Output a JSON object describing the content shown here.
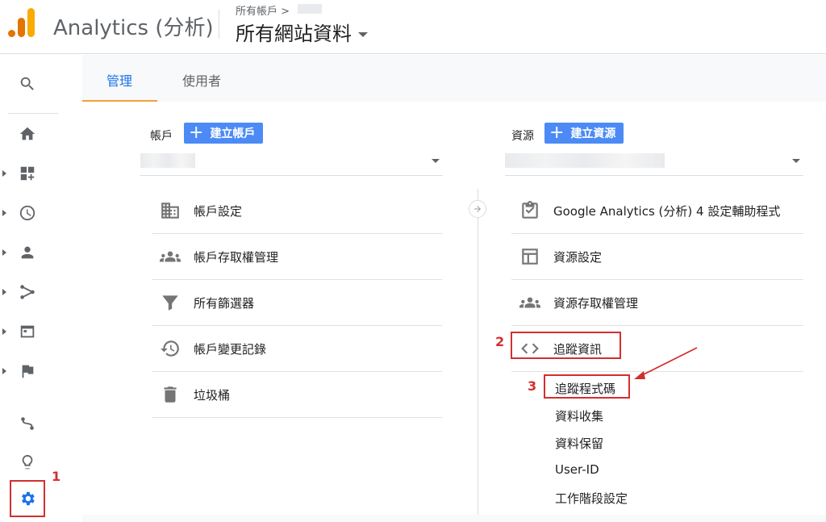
{
  "header": {
    "app_title": "Analytics (分析)",
    "breadcrumb": "所有帳戶 >",
    "property": "所有網站資料"
  },
  "tabs": [
    {
      "label": "管理"
    },
    {
      "label": "使用者"
    }
  ],
  "account_column": {
    "label": "帳戶",
    "create_button": "建立帳戶",
    "items": [
      {
        "label": "帳戶設定",
        "icon": "building-icon"
      },
      {
        "label": "帳戶存取權管理",
        "icon": "people-icon"
      },
      {
        "label": "所有篩選器",
        "icon": "filter-icon"
      },
      {
        "label": "帳戶變更記錄",
        "icon": "history-icon"
      },
      {
        "label": "垃圾桶",
        "icon": "trash-icon"
      }
    ]
  },
  "property_column": {
    "label": "資源",
    "create_button": "建立資源",
    "items": [
      {
        "label": "Google Analytics (分析) 4 設定輔助程式",
        "icon": "clipboard-check-icon"
      },
      {
        "label": "資源設定",
        "icon": "layout-icon"
      },
      {
        "label": "資源存取權管理",
        "icon": "people-icon"
      },
      {
        "label": "追蹤資訊",
        "icon": "code-icon"
      }
    ],
    "sub_items": [
      {
        "label": "追蹤程式碼"
      },
      {
        "label": "資料收集"
      },
      {
        "label": "資料保留"
      },
      {
        "label": "User-ID"
      },
      {
        "label": "工作階段設定"
      }
    ]
  },
  "annotations": {
    "step1": "1",
    "step2": "2",
    "step3": "3",
    "color": "#d32f2f"
  },
  "colors": {
    "accent": "#1a73e8",
    "button": "#4c8bf5",
    "tab_underline": "#f4a037"
  }
}
